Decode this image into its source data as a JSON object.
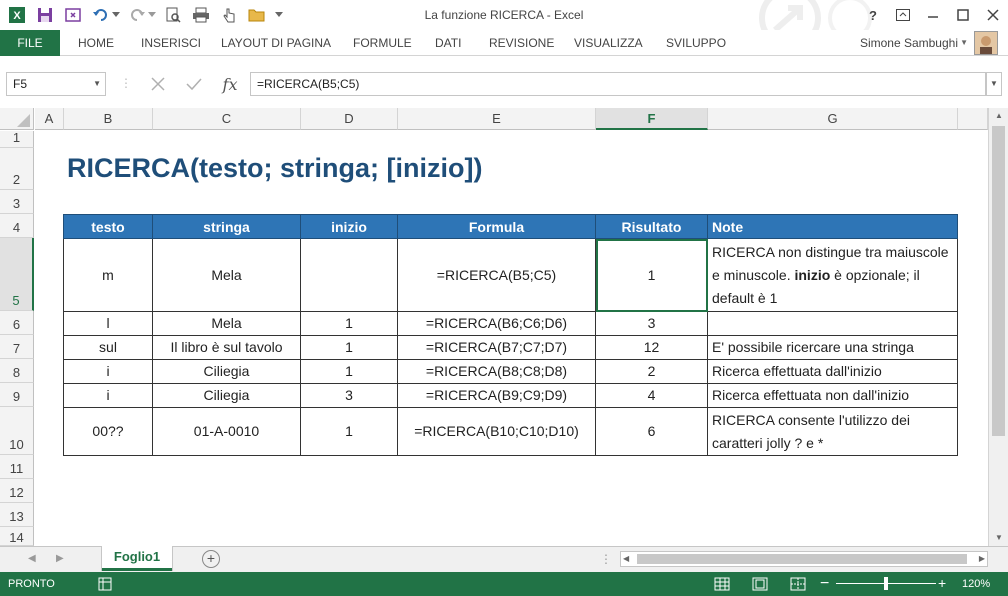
{
  "window": {
    "title": "La funzione RICERCA - Excel",
    "help": "?",
    "user_name": "Simone Sambughi"
  },
  "ribbon": {
    "file": "FILE",
    "tabs": [
      "HOME",
      "INSERISCI",
      "LAYOUT DI PAGINA",
      "FORMULE",
      "DATI",
      "REVISIONE",
      "VISUALIZZA",
      "SVILUPPO"
    ]
  },
  "formula_bar": {
    "name_box": "F5",
    "fx": "fx",
    "formula": "=RICERCA(B5;C5)"
  },
  "grid": {
    "columns": [
      "A",
      "B",
      "C",
      "D",
      "E",
      "F",
      "G"
    ],
    "selected_column": "F",
    "rows": [
      "1",
      "2",
      "3",
      "4",
      "5",
      "6",
      "7",
      "8",
      "9",
      "10",
      "11",
      "12",
      "13",
      "14"
    ],
    "selected_row": "5"
  },
  "sheet": {
    "title": "RICERCA(testo; stringa; [inizio])",
    "table": {
      "headers": [
        "testo",
        "stringa",
        "inizio",
        "Formula",
        "Risultato",
        "Note"
      ],
      "rows": [
        {
          "testo": "m",
          "stringa": "Mela",
          "inizio": "",
          "formula": "=RICERCA(B5;C5)",
          "risultato": "1",
          "note_a": "RICERCA non distingue tra maiuscole e minuscole. ",
          "note_b": "inizio",
          "note_c": " è opzionale; il default è 1"
        },
        {
          "testo": "l",
          "stringa": "Mela",
          "inizio": "1",
          "formula": "=RICERCA(B6;C6;D6)",
          "risultato": "3",
          "note": ""
        },
        {
          "testo": "sul",
          "stringa": "Il libro è sul tavolo",
          "inizio": "1",
          "formula": "=RICERCA(B7;C7;D7)",
          "risultato": "12",
          "note": "E' possibile ricercare una stringa"
        },
        {
          "testo": "i",
          "stringa": "Ciliegia",
          "inizio": "1",
          "formula": "=RICERCA(B8;C8;D8)",
          "risultato": "2",
          "note": "Ricerca effettuata dall'inizio"
        },
        {
          "testo": "i",
          "stringa": "Ciliegia",
          "inizio": "3",
          "formula": "=RICERCA(B9;C9;D9)",
          "risultato": "4",
          "note": "Ricerca effettuata non dall'inizio"
        },
        {
          "testo": "00??",
          "stringa": "01-A-0010",
          "inizio": "1",
          "formula": "=RICERCA(B10;C10;D10)",
          "risultato": "6",
          "note": "RICERCA consente l'utilizzo dei caratteri jolly ? e *"
        }
      ]
    }
  },
  "sheet_tabs": {
    "active": "Foglio1",
    "add": "+"
  },
  "status_bar": {
    "ready": "PRONTO",
    "zoom": "120%"
  },
  "colors": {
    "excel_green": "#217346",
    "header_blue": "#2e75b6",
    "title_blue": "#1f4e79"
  }
}
